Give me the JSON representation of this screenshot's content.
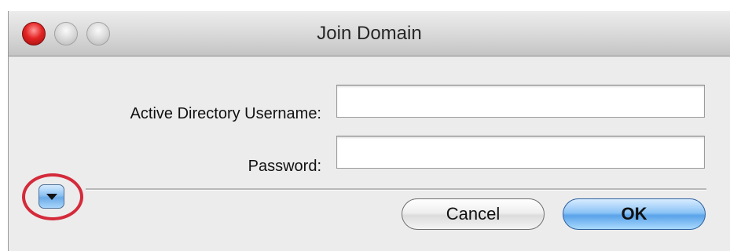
{
  "window": {
    "title": "Join Domain"
  },
  "form": {
    "username_label": "Active Directory Username:",
    "username_value": "",
    "password_label": "Password:",
    "password_value": ""
  },
  "buttons": {
    "cancel_label": "Cancel",
    "ok_label": "OK"
  },
  "icons": {
    "disclosure": "triangle-down-icon",
    "close": "close-icon",
    "minimize": "minimize-icon",
    "zoom": "zoom-icon"
  },
  "colors": {
    "highlight_ring": "#d42a3a",
    "default_button": "#8cc4f6",
    "close_button": "#e42424"
  }
}
